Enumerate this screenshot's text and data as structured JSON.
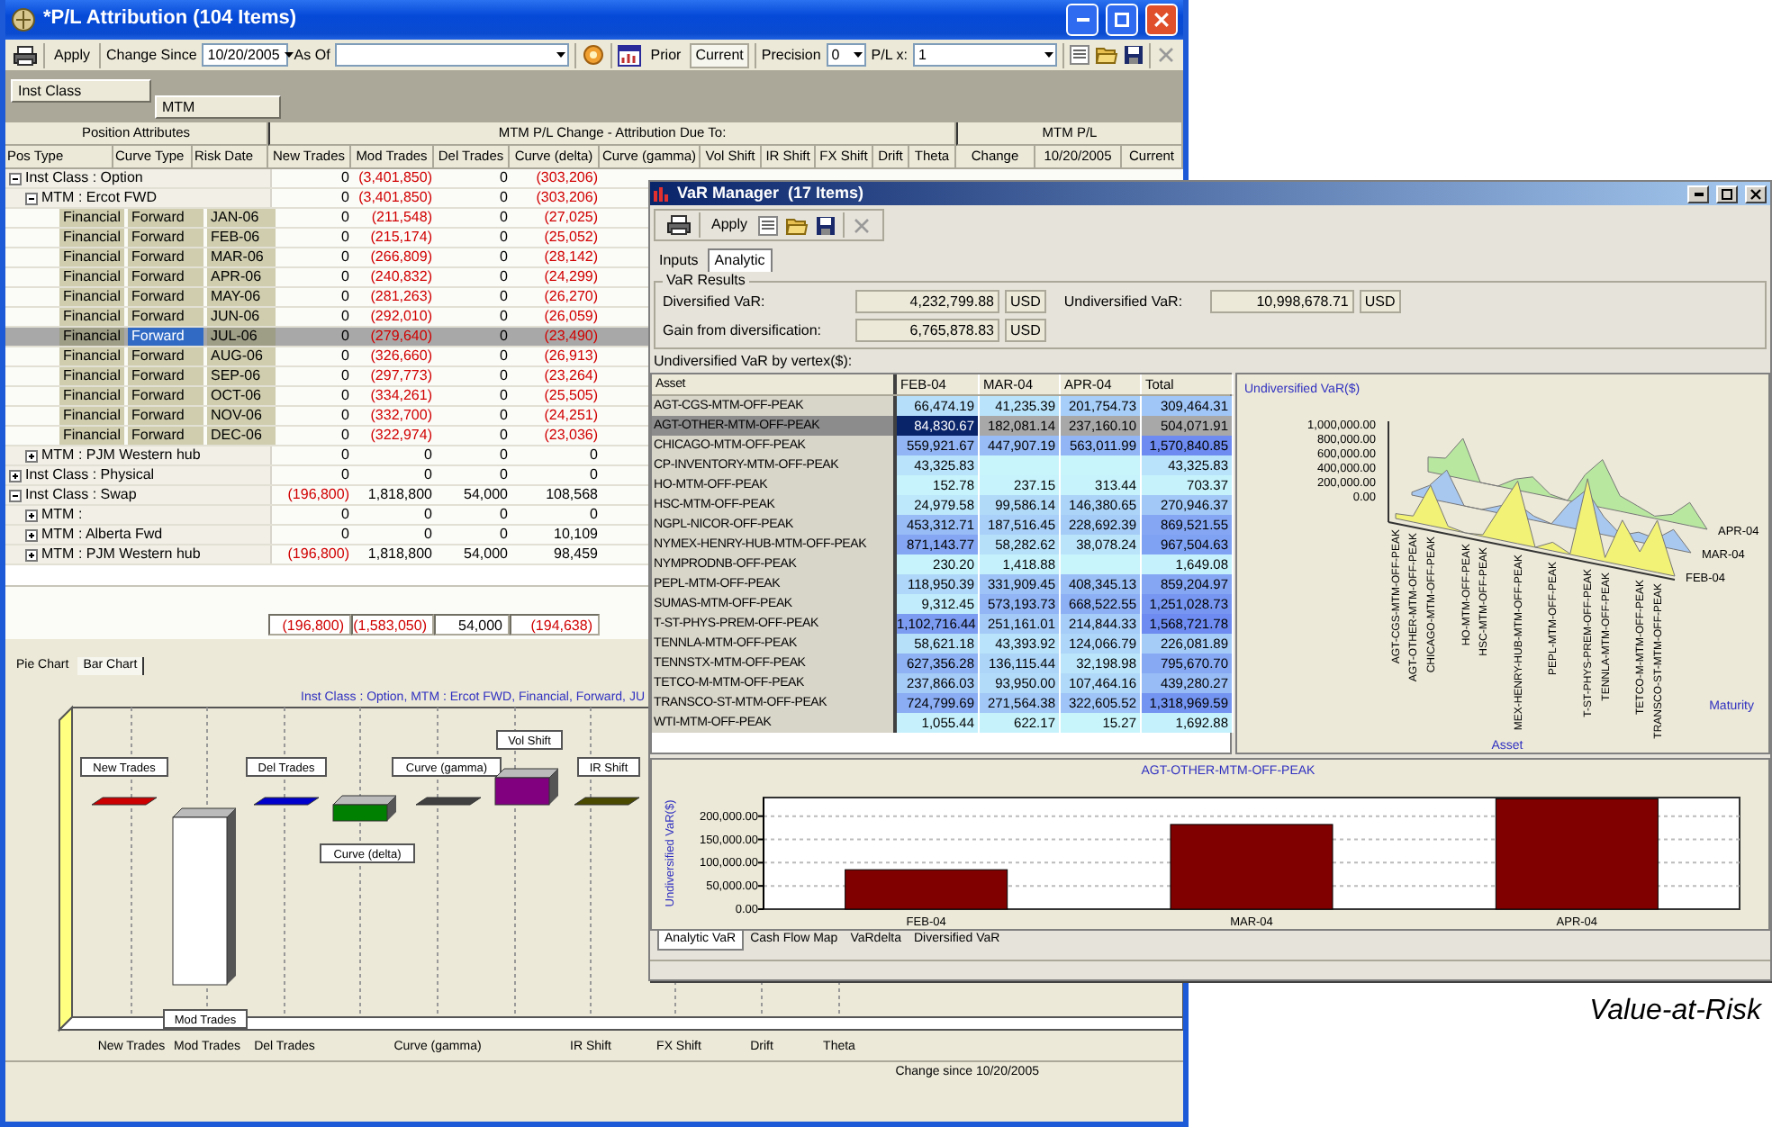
{
  "pl_window": {
    "title": "*P/L Attribution (104 Items)",
    "toolbar": {
      "apply": "Apply",
      "change_since_label": "Change Since",
      "change_since_date": "10/20/2005",
      "as_of_label": "As Of",
      "prior": "Prior",
      "current": "Current",
      "precision_label": "Precision",
      "precision": "0",
      "pl_multiplier_label": "P/L x:",
      "pl_multiplier": "1"
    },
    "group_by": [
      "Inst Class",
      "MTM"
    ],
    "table": {
      "column_groups": [
        {
          "label": "Position Attributes",
          "columns": [
            "Pos Type",
            "Curve Type",
            "Risk Date"
          ]
        },
        {
          "label": "MTM P/L Change - Attribution Due To:",
          "columns": [
            "New Trades",
            "Mod Trades",
            "Del Trades",
            "Curve (delta)",
            "Curve (gamma)",
            "Vol Shift",
            "IR Shift",
            "FX Shift",
            "Drift",
            "Theta"
          ]
        },
        {
          "label": "MTM P/L",
          "columns": [
            "Change",
            "10/20/2005",
            "Current"
          ]
        }
      ],
      "rows": [
        {
          "kind": "group",
          "label": "Inst Class : Option",
          "expanded": true,
          "selected": false,
          "values": [
            {
              "text": "0",
              "negative": false
            },
            {
              "text": "(3,401,850)",
              "negative": true
            },
            {
              "text": "0",
              "negative": false
            },
            {
              "text": "(303,206)",
              "negative": true
            }
          ],
          "children": [
            {
              "kind": "group",
              "label": "MTM : Ercot FWD",
              "expanded": true,
              "selected": false,
              "values": [
                {
                  "text": "0",
                  "negative": false
                },
                {
                  "text": "(3,401,850)",
                  "negative": true
                },
                {
                  "text": "0",
                  "negative": false
                },
                {
                  "text": "(303,206)",
                  "negative": true
                }
              ],
              "children": [
                {
                  "kind": "leaf",
                  "pos_type": "Financial",
                  "curve_type": "Forward",
                  "risk_date": "JAN-06",
                  "selected": false,
                  "values": [
                    {
                      "text": "0",
                      "negative": false
                    },
                    {
                      "text": "(211,548)",
                      "negative": true
                    },
                    {
                      "text": "0",
                      "negative": false
                    },
                    {
                      "text": "(27,025)",
                      "negative": true
                    }
                  ]
                },
                {
                  "kind": "leaf",
                  "pos_type": "Financial",
                  "curve_type": "Forward",
                  "risk_date": "FEB-06",
                  "selected": false,
                  "values": [
                    {
                      "text": "0",
                      "negative": false
                    },
                    {
                      "text": "(215,174)",
                      "negative": true
                    },
                    {
                      "text": "0",
                      "negative": false
                    },
                    {
                      "text": "(25,052)",
                      "negative": true
                    }
                  ]
                },
                {
                  "kind": "leaf",
                  "pos_type": "Financial",
                  "curve_type": "Forward",
                  "risk_date": "MAR-06",
                  "selected": false,
                  "values": [
                    {
                      "text": "0",
                      "negative": false
                    },
                    {
                      "text": "(266,809)",
                      "negative": true
                    },
                    {
                      "text": "0",
                      "negative": false
                    },
                    {
                      "text": "(28,142)",
                      "negative": true
                    }
                  ]
                },
                {
                  "kind": "leaf",
                  "pos_type": "Financial",
                  "curve_type": "Forward",
                  "risk_date": "APR-06",
                  "selected": false,
                  "values": [
                    {
                      "text": "0",
                      "negative": false
                    },
                    {
                      "text": "(240,832)",
                      "negative": true
                    },
                    {
                      "text": "0",
                      "negative": false
                    },
                    {
                      "text": "(24,299)",
                      "negative": true
                    }
                  ]
                },
                {
                  "kind": "leaf",
                  "pos_type": "Financial",
                  "curve_type": "Forward",
                  "risk_date": "MAY-06",
                  "selected": false,
                  "values": [
                    {
                      "text": "0",
                      "negative": false
                    },
                    {
                      "text": "(281,263)",
                      "negative": true
                    },
                    {
                      "text": "0",
                      "negative": false
                    },
                    {
                      "text": "(26,270)",
                      "negative": true
                    }
                  ]
                },
                {
                  "kind": "leaf",
                  "pos_type": "Financial",
                  "curve_type": "Forward",
                  "risk_date": "JUN-06",
                  "selected": false,
                  "values": [
                    {
                      "text": "0",
                      "negative": false
                    },
                    {
                      "text": "(292,010)",
                      "negative": true
                    },
                    {
                      "text": "0",
                      "negative": false
                    },
                    {
                      "text": "(26,059)",
                      "negative": true
                    }
                  ]
                },
                {
                  "kind": "leaf",
                  "pos_type": "Financial",
                  "curve_type": "Forward",
                  "risk_date": "JUL-06",
                  "selected": true,
                  "values": [
                    {
                      "text": "0",
                      "negative": false
                    },
                    {
                      "text": "(279,640)",
                      "negative": true
                    },
                    {
                      "text": "0",
                      "negative": false
                    },
                    {
                      "text": "(23,490)",
                      "negative": true
                    }
                  ]
                },
                {
                  "kind": "leaf",
                  "pos_type": "Financial",
                  "curve_type": "Forward",
                  "risk_date": "AUG-06",
                  "selected": false,
                  "values": [
                    {
                      "text": "0",
                      "negative": false
                    },
                    {
                      "text": "(326,660)",
                      "negative": true
                    },
                    {
                      "text": "0",
                      "negative": false
                    },
                    {
                      "text": "(26,913)",
                      "negative": true
                    }
                  ]
                },
                {
                  "kind": "leaf",
                  "pos_type": "Financial",
                  "curve_type": "Forward",
                  "risk_date": "SEP-06",
                  "selected": false,
                  "values": [
                    {
                      "text": "0",
                      "negative": false
                    },
                    {
                      "text": "(297,773)",
                      "negative": true
                    },
                    {
                      "text": "0",
                      "negative": false
                    },
                    {
                      "text": "(23,264)",
                      "negative": true
                    }
                  ]
                },
                {
                  "kind": "leaf",
                  "pos_type": "Financial",
                  "curve_type": "Forward",
                  "risk_date": "OCT-06",
                  "selected": false,
                  "values": [
                    {
                      "text": "0",
                      "negative": false
                    },
                    {
                      "text": "(334,261)",
                      "negative": true
                    },
                    {
                      "text": "0",
                      "negative": false
                    },
                    {
                      "text": "(25,505)",
                      "negative": true
                    }
                  ]
                },
                {
                  "kind": "leaf",
                  "pos_type": "Financial",
                  "curve_type": "Forward",
                  "risk_date": "NOV-06",
                  "selected": false,
                  "values": [
                    {
                      "text": "0",
                      "negative": false
                    },
                    {
                      "text": "(332,700)",
                      "negative": true
                    },
                    {
                      "text": "0",
                      "negative": false
                    },
                    {
                      "text": "(24,251)",
                      "negative": true
                    }
                  ]
                },
                {
                  "kind": "leaf",
                  "pos_type": "Financial",
                  "curve_type": "Forward",
                  "risk_date": "DEC-06",
                  "selected": false,
                  "values": [
                    {
                      "text": "0",
                      "negative": false
                    },
                    {
                      "text": "(322,974)",
                      "negative": true
                    },
                    {
                      "text": "0",
                      "negative": false
                    },
                    {
                      "text": "(23,036)",
                      "negative": true
                    }
                  ]
                }
              ]
            },
            {
              "kind": "group",
              "label": "MTM : PJM Western hub",
              "expanded": false,
              "selected": false,
              "values": [
                {
                  "text": "0",
                  "negative": false
                },
                {
                  "text": "0",
                  "negative": false
                },
                {
                  "text": "0",
                  "negative": false
                },
                {
                  "text": "0",
                  "negative": false
                }
              ]
            }
          ]
        },
        {
          "kind": "group",
          "label": "Inst Class : Physical",
          "expanded": false,
          "selected": false,
          "values": [
            {
              "text": "0",
              "negative": false
            },
            {
              "text": "0",
              "negative": false
            },
            {
              "text": "0",
              "negative": false
            },
            {
              "text": "0",
              "negative": false
            }
          ]
        },
        {
          "kind": "group",
          "label": "Inst Class : Swap",
          "expanded": true,
          "selected": false,
          "values": [
            {
              "text": "(196,800)",
              "negative": true
            },
            {
              "text": "1,818,800",
              "negative": false
            },
            {
              "text": "54,000",
              "negative": false
            },
            {
              "text": "108,568",
              "negative": false
            }
          ],
          "children": [
            {
              "kind": "group",
              "label": "MTM :",
              "expanded": false,
              "selected": false,
              "values": [
                {
                  "text": "0",
                  "negative": false
                },
                {
                  "text": "0",
                  "negative": false
                },
                {
                  "text": "0",
                  "negative": false
                },
                {
                  "text": "0",
                  "negative": false
                }
              ]
            },
            {
              "kind": "group",
              "label": "MTM : Alberta Fwd",
              "expanded": false,
              "selected": false,
              "values": [
                {
                  "text": "0",
                  "negative": false
                },
                {
                  "text": "0",
                  "negative": false
                },
                {
                  "text": "0",
                  "negative": false
                },
                {
                  "text": "10,109",
                  "negative": false
                }
              ]
            },
            {
              "kind": "group",
              "label": "MTM : PJM Western hub",
              "expanded": false,
              "selected": false,
              "values": [
                {
                  "text": "(196,800)",
                  "negative": true
                },
                {
                  "text": "1,818,800",
                  "negative": false
                },
                {
                  "text": "54,000",
                  "negative": false
                },
                {
                  "text": "98,459",
                  "negative": false
                }
              ]
            }
          ]
        }
      ],
      "totals": [
        {
          "text": "(196,800)",
          "negative": true
        },
        {
          "text": "(1,583,050)",
          "negative": true
        },
        {
          "text": "54,000",
          "negative": false
        },
        {
          "text": "(194,638)",
          "negative": true
        }
      ]
    },
    "chart_tabs": [
      {
        "label": "Pie Chart",
        "selected": false
      },
      {
        "label": "Bar Chart",
        "selected": true
      }
    ],
    "chart": {
      "title": "Inst Class : Option, MTM : Ercot FWD, Financial, Forward, JU",
      "bars": [
        {
          "label": "New Trades",
          "color": "#cc0000"
        },
        {
          "label": "Mod Trades",
          "color": "#ffffff"
        },
        {
          "label": "Del Trades",
          "color": "#0000cc"
        },
        {
          "label": "Curve (delta)",
          "color": "#008000"
        },
        {
          "label": "Curve (gamma)",
          "color": "#404040"
        },
        {
          "label": "Vol Shift",
          "color": "#800080"
        },
        {
          "label": "IR Shift",
          "color": "#4a4a00"
        }
      ],
      "axis_labels": [
        "New Trades",
        "Mod Trades",
        "Del Trades",
        "Curve (gamma)",
        "IR Shift",
        "FX Shift",
        "Drift",
        "Theta"
      ]
    },
    "status": "Change since 10/20/2005"
  },
  "var_window": {
    "title": "VaR Manager  (17 Items)",
    "apply": "Apply",
    "tabs": [
      {
        "label": "Inputs",
        "selected": false
      },
      {
        "label": "Analytic",
        "selected": true
      }
    ],
    "results_title": "VaR Results",
    "results": [
      {
        "label": "Diversified VaR:",
        "value": "4,232,799.88",
        "unit": "USD"
      },
      {
        "label": "Undiversified VaR:",
        "value": "10,998,678.71",
        "unit": "USD"
      },
      {
        "label": "Gain from diversification:",
        "value": "6,765,878.83",
        "unit": "USD"
      }
    ],
    "table_caption": "Undiversified VaR by vertex($):",
    "table": {
      "columns": [
        "Asset",
        "FEB-04",
        "MAR-04",
        "APR-04",
        "Total"
      ],
      "rows": [
        {
          "asset": "AGT-CGS-MTM-OFF-PEAK",
          "selected": false,
          "feb_04": "66,474.19",
          "mar_04": "41,235.39",
          "apr_04": "201,754.73",
          "total": "309,464.31"
        },
        {
          "asset": "AGT-OTHER-MTM-OFF-PEAK",
          "selected": true,
          "feb_04": "84,830.67",
          "mar_04": "182,081.14",
          "apr_04": "237,160.10",
          "total": "504,071.91"
        },
        {
          "asset": "CHICAGO-MTM-OFF-PEAK",
          "selected": false,
          "feb_04": "559,921.67",
          "mar_04": "447,907.19",
          "apr_04": "563,011.99",
          "total": "1,570,840.85"
        },
        {
          "asset": "CP-INVENTORY-MTM-OFF-PEAK",
          "selected": false,
          "feb_04": "43,325.83",
          "total": "43,325.83"
        },
        {
          "asset": "HO-MTM-OFF-PEAK",
          "selected": false,
          "feb_04": "152.78",
          "mar_04": "237.15",
          "apr_04": "313.44",
          "total": "703.37"
        },
        {
          "asset": "HSC-MTM-OFF-PEAK",
          "selected": false,
          "feb_04": "24,979.58",
          "mar_04": "99,586.14",
          "apr_04": "146,380.65",
          "total": "270,946.37"
        },
        {
          "asset": "NGPL-NICOR-OFF-PEAK",
          "selected": false,
          "feb_04": "453,312.71",
          "mar_04": "187,516.45",
          "apr_04": "228,692.39",
          "total": "869,521.55"
        },
        {
          "asset": "NYMEX-HENRY-HUB-MTM-OFF-PEAK",
          "selected": false,
          "feb_04": "871,143.77",
          "mar_04": "58,282.62",
          "apr_04": "38,078.24",
          "total": "967,504.63"
        },
        {
          "asset": "NYMPRODNB-OFF-PEAK",
          "selected": false,
          "feb_04": "230.20",
          "mar_04": "1,418.88",
          "total": "1,649.08"
        },
        {
          "asset": "PEPL-MTM-OFF-PEAK",
          "selected": false,
          "feb_04": "118,950.39",
          "mar_04": "331,909.45",
          "apr_04": "408,345.13",
          "total": "859,204.97"
        },
        {
          "asset": "SUMAS-MTM-OFF-PEAK",
          "selected": false,
          "feb_04": "9,312.45",
          "mar_04": "573,193.73",
          "apr_04": "668,522.55",
          "total": "1,251,028.73"
        },
        {
          "asset": "T-ST-PHYS-PREM-OFF-PEAK",
          "selected": false,
          "feb_04": "1,102,716.44",
          "mar_04": "251,161.01",
          "apr_04": "214,844.33",
          "total": "1,568,721.78"
        },
        {
          "asset": "TENNLA-MTM-OFF-PEAK",
          "selected": false,
          "feb_04": "58,621.18",
          "mar_04": "43,393.92",
          "apr_04": "124,066.79",
          "total": "226,081.89"
        },
        {
          "asset": "TENNSTX-MTM-OFF-PEAK",
          "selected": false,
          "feb_04": "627,356.28",
          "mar_04": "136,115.44",
          "apr_04": "32,198.98",
          "total": "795,670.70"
        },
        {
          "asset": "TETCO-M-MTM-OFF-PEAK",
          "selected": false,
          "feb_04": "237,866.03",
          "mar_04": "93,950.00",
          "apr_04": "107,464.16",
          "total": "439,280.27"
        },
        {
          "asset": "TRANSCO-ST-MTM-OFF-PEAK",
          "selected": false,
          "feb_04": "724,799.69",
          "mar_04": "271,564.38",
          "apr_04": "322,605.52",
          "total": "1,318,969.59"
        },
        {
          "asset": "WTI-MTM-OFF-PEAK",
          "selected": false,
          "feb_04": "1,055.44",
          "mar_04": "622.17",
          "apr_04": "15.27",
          "total": "1,692.88"
        }
      ]
    },
    "surface_chart": {
      "title": "Undiversified VaR($)",
      "y_tick_labels": [
        "1,000,000.00",
        "800,000.00",
        "600,000.00",
        "400,000.00",
        "200,000.00",
        "0.00"
      ],
      "asset_labels": [
        "AGT-CGS-MTM-OFF-PEAK",
        "AGT-OTHER-MTM-OFF-PEAK",
        "CHICAGO-MTM-OFF-PEAK",
        "HO-MTM-OFF-PEAK",
        "HSC-MTM-OFF-PEAK",
        "MEX-HENRY-HUB-MTM-OFF-PEAK",
        "PEPL-MTM-OFF-PEAK",
        "T-ST-PHYS-PREM-OFF-PEAK",
        "TENNLA-MTM-OFF-PEAK",
        "TETCO-M-MTM-OFF-PEAK",
        "TRANSCO-ST-MTM-OFF-PEAK"
      ],
      "maturity_labels": [
        "APR-04",
        "MAR-04",
        "FEB-04"
      ],
      "asset_axis_title": "Asset",
      "maturity_axis_title": "Maturity"
    },
    "bar_chart": {
      "chart_data": {
        "type": "bar",
        "title": "AGT-OTHER-MTM-OFF-PEAK",
        "ylabel": "Undiversified VaR($)",
        "categories": [
          "FEB-04",
          "MAR-04",
          "APR-04"
        ],
        "series": [
          {
            "color": "#800000",
            "values": [
              84830.67,
              182081.14,
              237160.1
            ]
          }
        ],
        "ylim": [
          0,
          240000
        ],
        "grid": true,
        "yticks": [
          {
            "value": 0,
            "label": "0.00"
          },
          {
            "value": 50000,
            "label": "50,000.00"
          },
          {
            "value": 100000,
            "label": "100,000.00"
          },
          {
            "value": 150000,
            "label": "150,000.00"
          },
          {
            "value": 200000,
            "label": "200,000.00"
          }
        ]
      }
    },
    "bottom_tabs": [
      {
        "label": "Analytic VaR",
        "selected": true
      },
      {
        "label": "Cash Flow Map",
        "selected": false
      },
      {
        "label": "VaRdelta",
        "selected": false
      },
      {
        "label": "Diversified VaR",
        "selected": false
      }
    ]
  },
  "caption": "Value-at-Risk"
}
